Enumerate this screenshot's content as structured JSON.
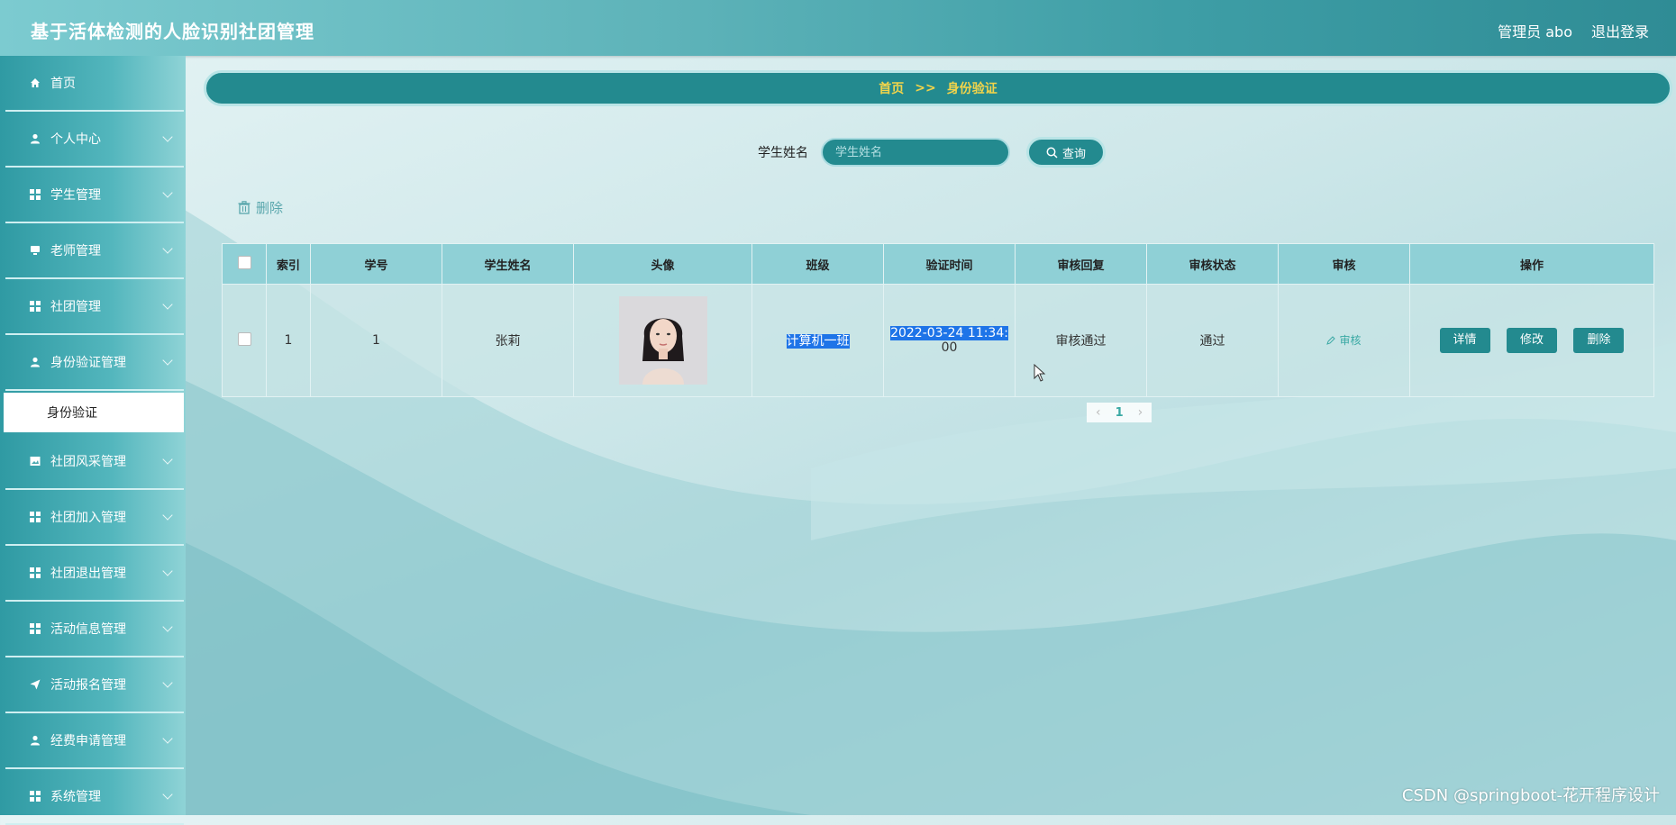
{
  "app": {
    "title": "基于活体检测的人脸识别社团管理",
    "admin_label": "管理员 abo",
    "logout_label": "退出登录"
  },
  "sidebar": {
    "items": [
      {
        "label": "首页",
        "icon": "home-icon",
        "has_chevron": false
      },
      {
        "label": "个人中心",
        "icon": "user-icon",
        "has_chevron": true
      },
      {
        "label": "学生管理",
        "icon": "grid-icon",
        "has_chevron": true
      },
      {
        "label": "老师管理",
        "icon": "desktop-icon",
        "has_chevron": true
      },
      {
        "label": "社团管理",
        "icon": "grid-icon",
        "has_chevron": true
      },
      {
        "label": "身份验证管理",
        "icon": "user-icon",
        "has_chevron": true
      },
      {
        "label": "社团风采管理",
        "icon": "image-icon",
        "has_chevron": true
      },
      {
        "label": "社团加入管理",
        "icon": "grid-icon",
        "has_chevron": true
      },
      {
        "label": "社团退出管理",
        "icon": "grid-icon",
        "has_chevron": true
      },
      {
        "label": "活动信息管理",
        "icon": "grid-icon",
        "has_chevron": true
      },
      {
        "label": "活动报名管理",
        "icon": "send-icon",
        "has_chevron": true
      },
      {
        "label": "经费申请管理",
        "icon": "user-icon",
        "has_chevron": true
      },
      {
        "label": "系统管理",
        "icon": "grid-icon",
        "has_chevron": true
      }
    ],
    "submenu": {
      "label": "身份验证"
    }
  },
  "breadcrumb": {
    "home": "首页",
    "separator": ">>",
    "current": "身份验证"
  },
  "search": {
    "label": "学生姓名",
    "placeholder": "学生姓名",
    "value": "",
    "button_label": "查询"
  },
  "toolbar": {
    "delete_label": "删除"
  },
  "table": {
    "headers": [
      "索引",
      "学号",
      "学生姓名",
      "头像",
      "班级",
      "验证时间",
      "审核回复",
      "审核状态",
      "审核",
      "操作"
    ],
    "rows": [
      {
        "index": "1",
        "student_id": "1",
        "name": "张莉",
        "class": "计算机一班",
        "verify_time_a": "2022-03-24 11:34:",
        "verify_time_b": "00",
        "reply": "审核通过",
        "status": "通过",
        "audit_label": "审核",
        "actions": {
          "detail": "详情",
          "edit": "修改",
          "delete": "删除"
        }
      }
    ]
  },
  "pagination": {
    "current_page": "1",
    "prev": "‹",
    "next": "›"
  },
  "colors": {
    "primary": "#238a8f",
    "breadcrumb_text": "#f2d44a",
    "header_bg": "#8fd0d6",
    "highlight": "#1e74e8"
  },
  "watermark": "CSDN @springboot-花开程序设计"
}
